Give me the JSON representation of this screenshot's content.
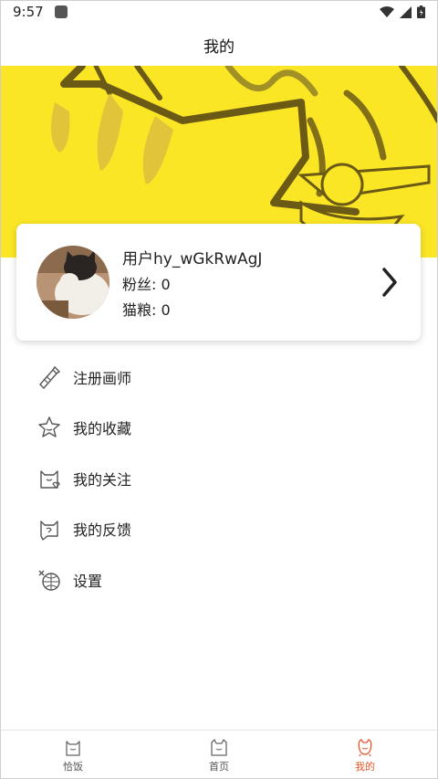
{
  "status_bar": {
    "time": "9:57"
  },
  "header": {
    "title": "我的"
  },
  "profile": {
    "username": "用户hy_wGkRwAgJ",
    "fans": "粉丝: 0",
    "cat_food": "猫粮: 0"
  },
  "menu": {
    "items": [
      {
        "label": "注册画师",
        "icon": "brush-icon"
      },
      {
        "label": "我的收藏",
        "icon": "star-icon"
      },
      {
        "label": "我的关注",
        "icon": "cat-heart-icon"
      },
      {
        "label": "我的反馈",
        "icon": "feedback-icon"
      },
      {
        "label": "设置",
        "icon": "settings-icon"
      }
    ]
  },
  "bottom_nav": {
    "tabs": [
      {
        "label": "恰饭",
        "icon": "cat-bag-icon"
      },
      {
        "label": "首页",
        "icon": "cat-home-icon"
      },
      {
        "label": "我的",
        "icon": "cat-me-icon",
        "active": true
      }
    ]
  },
  "colors": {
    "accent": "#e8572b",
    "banner": "#fbe626"
  }
}
